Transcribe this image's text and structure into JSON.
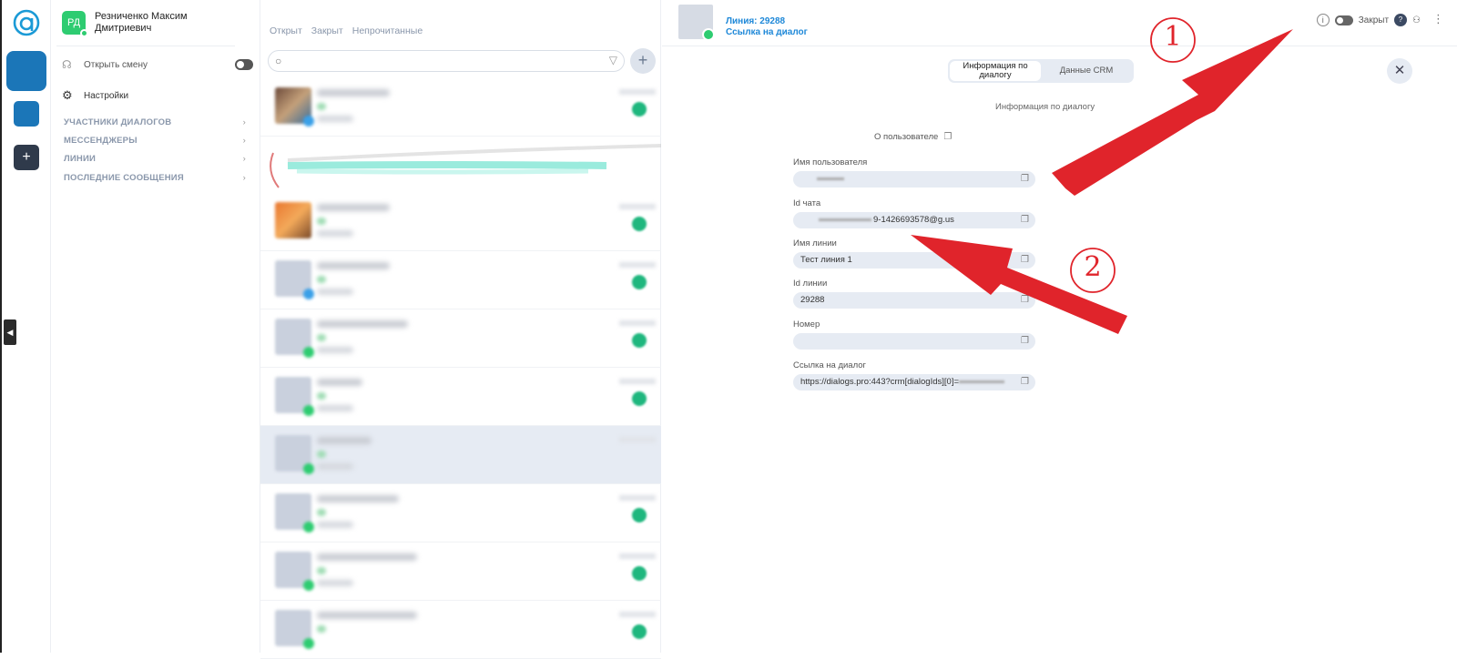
{
  "user": {
    "initials": "РД",
    "name": "Резниченко Максим Дмитриевич"
  },
  "sidebar": {
    "open_shift": "Открыть смену",
    "settings": "Настройки",
    "sections": [
      "УЧАСТНИКИ ДИАЛОГОВ",
      "МЕССЕНДЖЕРЫ",
      "ЛИНИИ",
      "ПОСЛЕДНИЕ СООБЩЕНИЯ"
    ]
  },
  "chatlist": {
    "tabs": [
      "Открыт",
      "Закрыт",
      "Непрочитанные"
    ],
    "search_placeholder": ""
  },
  "panel": {
    "header": {
      "line": "Линия: 29288",
      "link": "Ссылка на диалог",
      "status": "Закрыт",
      "help": "?"
    },
    "tabs": [
      "Информация по диалогу",
      "Данные CRM"
    ],
    "subtitle": "Информация по диалогу",
    "about_user": "О пользователе",
    "fields": [
      {
        "label": "Имя пользователя",
        "value": "",
        "blurred": true
      },
      {
        "label": "Id чата",
        "value": "9-1426693578@g.us",
        "blurred": true
      },
      {
        "label": "Имя линии",
        "value": "Тест линия 1",
        "blurred": false
      },
      {
        "label": "Id линии",
        "value": "29288",
        "blurred": false
      },
      {
        "label": "Номер",
        "value": "",
        "blurred": false
      },
      {
        "label": "Ссылка на диалог",
        "value": "https://dialogs.pro:443?crm[dialogIds][0]=",
        "blurred": true
      }
    ]
  },
  "annotations": {
    "num1": "1",
    "num2": "2",
    "arrow_color": "#e0242b"
  },
  "colors": {
    "accent_blue": "#1e88d8",
    "tile_blue": "#1b76b8",
    "green": "#2ecc71"
  }
}
